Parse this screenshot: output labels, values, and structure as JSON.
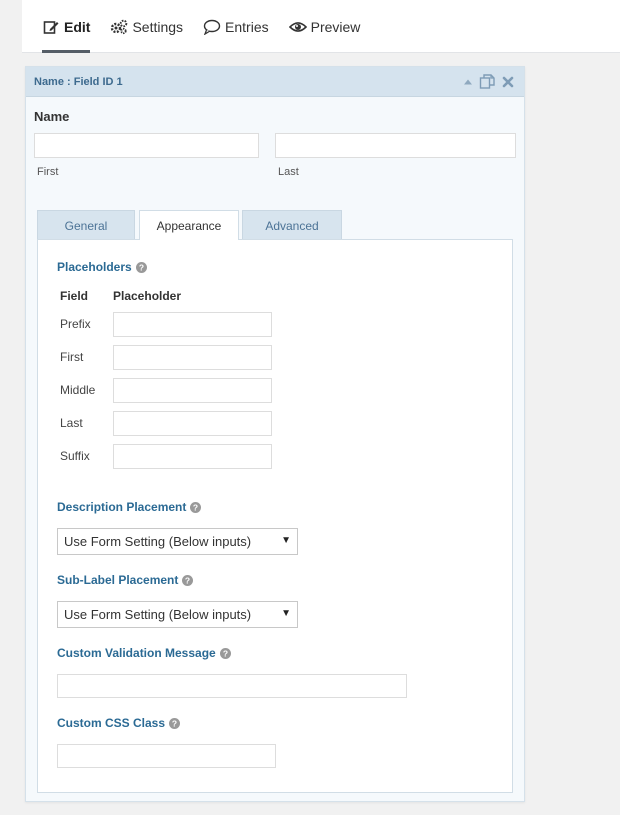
{
  "toolbar": {
    "tabs": [
      {
        "label": "Edit",
        "icon": "edit-icon",
        "active": true
      },
      {
        "label": "Settings",
        "icon": "gears-icon",
        "active": false
      },
      {
        "label": "Entries",
        "icon": "speech-bubble-icon",
        "active": false
      },
      {
        "label": "Preview",
        "icon": "eye-icon",
        "active": false
      }
    ]
  },
  "field": {
    "header_title": "Name : Field ID 1",
    "label": "Name",
    "first_label": "First",
    "last_label": "Last",
    "first_value": "",
    "last_value": ""
  },
  "settings_tabs": [
    {
      "label": "General",
      "active": false
    },
    {
      "label": "Appearance",
      "active": true
    },
    {
      "label": "Advanced",
      "active": false
    }
  ],
  "appearance": {
    "placeholders_title": "Placeholders",
    "col_field": "Field",
    "col_placeholder": "Placeholder",
    "rows": [
      {
        "label": "Prefix",
        "value": ""
      },
      {
        "label": "First",
        "value": ""
      },
      {
        "label": "Middle",
        "value": ""
      },
      {
        "label": "Last",
        "value": ""
      },
      {
        "label": "Suffix",
        "value": ""
      }
    ],
    "description_placement_title": "Description Placement",
    "description_placement_value": "Use Form Setting (Below inputs)",
    "sublabel_placement_title": "Sub-Label Placement",
    "sublabel_placement_value": "Use Form Setting (Below inputs)",
    "custom_validation_title": "Custom Validation Message",
    "custom_validation_value": "",
    "custom_css_title": "Custom CSS Class",
    "custom_css_value": ""
  },
  "colors": {
    "accent": "#2b6a94",
    "panel_header": "#d5e3ee",
    "tab_inactive": "#d7e4ee"
  }
}
